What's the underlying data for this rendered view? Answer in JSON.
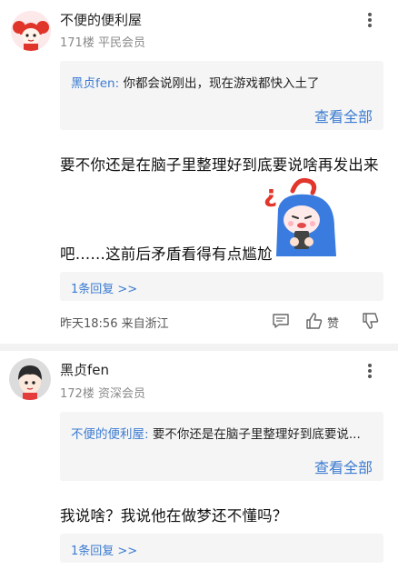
{
  "comments": [
    {
      "username": "不便的便利屋",
      "floor_info": "171楼 平民会员",
      "quote": {
        "author": "黑贞fen:",
        "text": "你都会说刚出，现在游戏都快入土了"
      },
      "view_all": "查看全部",
      "body_line1": "要不你还是在脑子里整理好到底要说啥再发出来",
      "body_line2": "吧……这前后矛盾看得有点尴尬",
      "replies": "1条回复 >>",
      "time": "昨天18:56",
      "location": "来自浙江",
      "like_label": "赞",
      "avatar_icon": "red-hair-girl-avatar",
      "sticker_icon": "blue-hooded-character-sticker"
    },
    {
      "username": "黑贞fen",
      "floor_info": "172楼 资深会员",
      "quote": {
        "author": "不便的便利屋:",
        "text": "要不你还是在脑子里整理好到底要说..."
      },
      "view_all": "查看全部",
      "body_line1": "我说啥？我说他在做梦还不懂吗？",
      "replies": "1条回复 >>",
      "avatar_icon": "black-hair-boy-avatar"
    }
  ],
  "colors": {
    "link": "#3b7bd1",
    "panel": "#f5f5f5",
    "text": "#222222",
    "meta": "#8a8a8a"
  }
}
